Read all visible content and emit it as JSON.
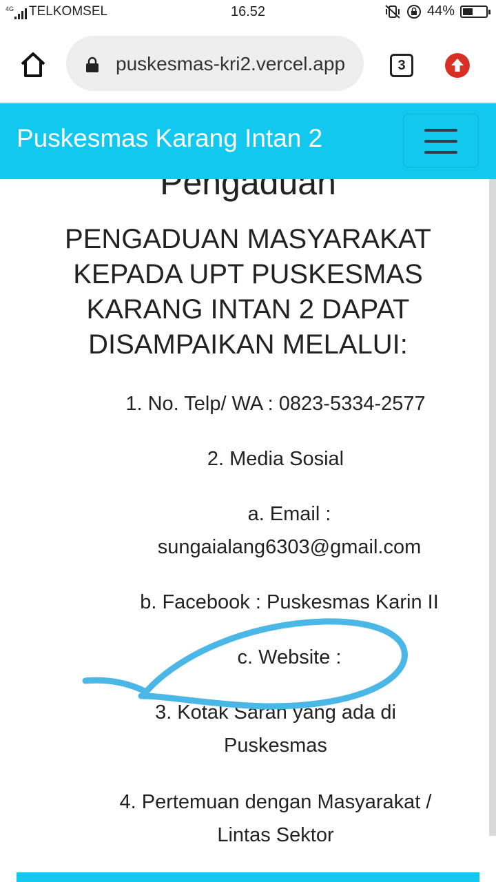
{
  "status_bar": {
    "network": "4G",
    "carrier": "TELKOMSEL",
    "time": "16.52",
    "battery_percent": "44%",
    "battery_level": 0.44
  },
  "browser": {
    "url": "puskesmas-kri2.vercel.app",
    "tab_count": "3",
    "home_icon": "home-icon",
    "lock_icon": "lock-icon",
    "update_icon": "update-icon"
  },
  "navbar": {
    "brand": "Puskesmas Karang Intan 2",
    "menu_icon": "hamburger-menu-icon",
    "color": "#12c8ee"
  },
  "content": {
    "title": "Pengaduan",
    "intro": "PENGADUAN MASYARAKAT KEPADA UPT PUSKESMAS KARANG INTAN 2 DAPAT DISAMPAIKAN MELALUI:",
    "items": [
      "1. No. Telp/ WA : 0823-5334-2577",
      "2. Media Sosial",
      "a. Email : sungaialang6303@gmail.com",
      "b. Facebook : Puskesmas Karin II",
      "c. Website :",
      "3. Kotak Saran yang ada di Puskesmas",
      "4. Pertemuan dengan Masyarakat / Lintas Sektor"
    ]
  },
  "colors": {
    "accent": "#12c8ee",
    "annotation": "#4bb7e6",
    "update_button": "#d93025"
  }
}
